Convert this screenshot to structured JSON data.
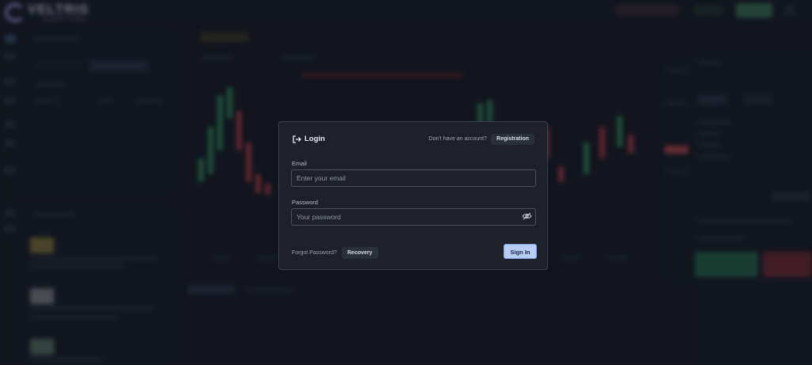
{
  "brand": {
    "name": "VELTRIS",
    "subname": "CAPITAL",
    "accent": "#b79cf0"
  },
  "modal": {
    "title": "Login",
    "title_icon": "login-arrow-icon",
    "no_account_text": "Don't have an account?",
    "registration_label": "Registration",
    "email": {
      "label": "Email",
      "placeholder": "Enter your email",
      "value": ""
    },
    "password": {
      "label": "Password",
      "placeholder": "Your password",
      "value": "",
      "toggle_icon": "eye-off-icon"
    },
    "forgot_text": "Forgot Password?",
    "recovery_label": "Recovery",
    "signin_label": "Sign In"
  },
  "colors": {
    "background": "#14171f",
    "modal_bg": "#1e2129",
    "signin_button": "#b7cdf6",
    "buy_green": "#1f6b4a",
    "sell_red": "#7a2730"
  }
}
